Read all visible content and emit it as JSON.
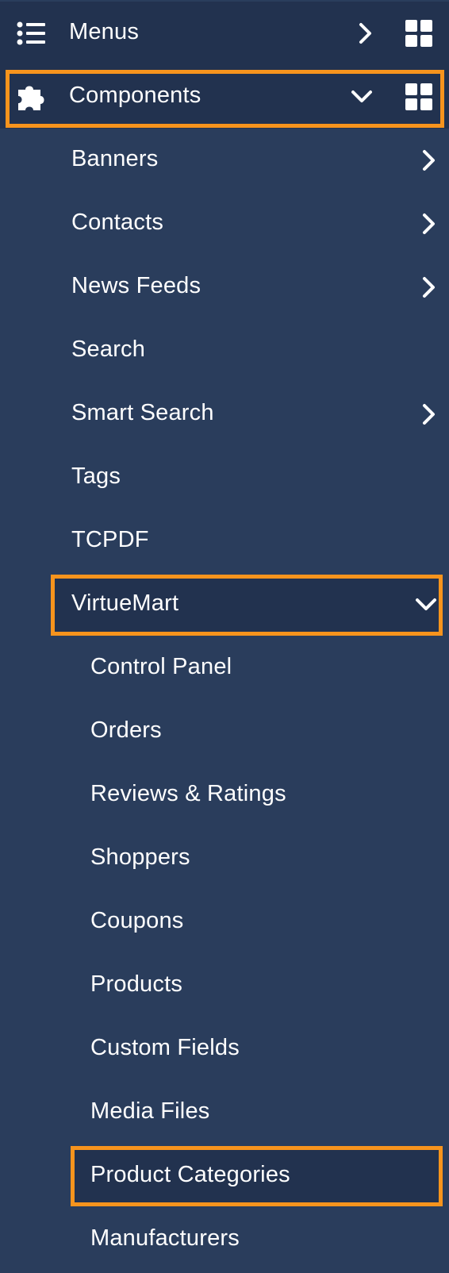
{
  "top_items": [
    {
      "label": "Menus",
      "icon": "list-icon",
      "chevron": "chevron-right-icon"
    },
    {
      "label": "Components",
      "icon": "puzzle-icon",
      "chevron": "chevron-down-icon"
    }
  ],
  "components": [
    {
      "label": "Banners",
      "has_submenu": true
    },
    {
      "label": "Contacts",
      "has_submenu": true
    },
    {
      "label": "News Feeds",
      "has_submenu": true
    },
    {
      "label": "Search",
      "has_submenu": false
    },
    {
      "label": "Smart Search",
      "has_submenu": true
    },
    {
      "label": "Tags",
      "has_submenu": false
    },
    {
      "label": "TCPDF",
      "has_submenu": false
    },
    {
      "label": "VirtueMart",
      "has_submenu": true,
      "expanded": true
    }
  ],
  "virtuemart": [
    {
      "label": "Control Panel"
    },
    {
      "label": "Orders"
    },
    {
      "label": "Reviews & Ratings"
    },
    {
      "label": "Shoppers"
    },
    {
      "label": "Coupons"
    },
    {
      "label": "Products"
    },
    {
      "label": "Custom Fields"
    },
    {
      "label": "Media Files"
    },
    {
      "label": "Product Categories",
      "highlighted": true
    },
    {
      "label": "Manufacturers"
    }
  ],
  "colors": {
    "background": "#2a3d5c",
    "top_row_background": "#22324f",
    "highlight_border": "#f7941d",
    "text": "#ffffff"
  }
}
